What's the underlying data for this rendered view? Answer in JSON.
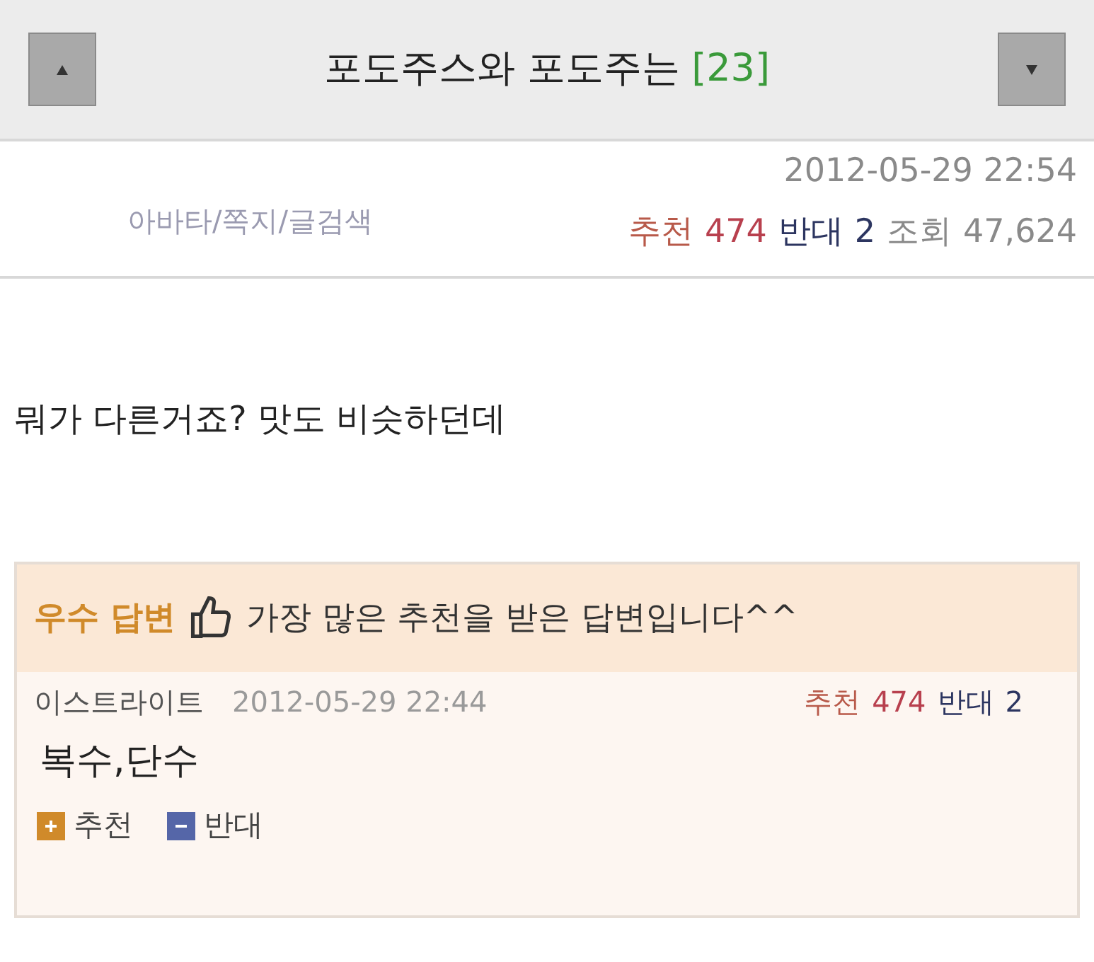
{
  "header": {
    "title": "포도주스와 포도주는",
    "comment_count": "[23]"
  },
  "meta": {
    "date": "2012-05-29 22:54",
    "links": "아바타/쪽지/글검색",
    "stats": [
      {
        "kind": "up",
        "label": "추천",
        "value": "474"
      },
      {
        "kind": "down",
        "label": "반대",
        "value": "2"
      },
      {
        "kind": "views",
        "label": "조회",
        "value": "47,624"
      }
    ]
  },
  "question": "뭐가 다른거죠? 맛도 비슷하던데",
  "best_answer": {
    "badge": "우수 답변",
    "note": "가장 많은 추천을 받은 답변입니다^^",
    "author": "이스트라이트",
    "date": "2012-05-29 22:44",
    "stats": [
      {
        "kind": "up",
        "label": "추천",
        "value": "474"
      },
      {
        "kind": "down",
        "label": "반대",
        "value": "2"
      }
    ],
    "text": "복수,단수",
    "actions": [
      {
        "kind": "up",
        "label": "추천"
      },
      {
        "kind": "down",
        "label": "반대"
      }
    ]
  }
}
